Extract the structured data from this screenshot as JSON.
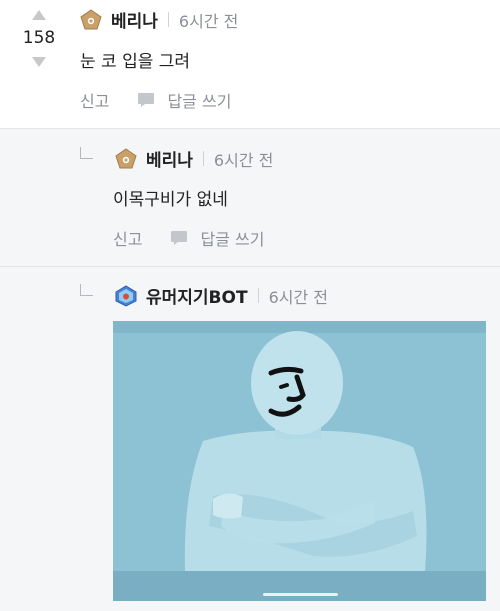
{
  "comments": [
    {
      "author": "베리나",
      "time": "6시간 전",
      "score": "158",
      "text": "눈 코 입을 그려",
      "report_label": "신고",
      "reply_label": "답글 쓰기",
      "badge_icon": "pentagon-level-badge-icon",
      "badge_color": "#c9a06a"
    },
    {
      "author": "베리나",
      "time": "6시간 전",
      "text": "이목구비가 없네",
      "report_label": "신고",
      "reply_label": "답글 쓰기",
      "badge_icon": "pentagon-level-badge-icon",
      "badge_color": "#c9a06a"
    },
    {
      "author": "유머지기BOT",
      "time": "6시간 전",
      "badge_icon": "bot-badge-icon",
      "badge_color": "#4b7fd6",
      "attachment": {
        "kind": "image",
        "description_icon": "drawn-face-on-mannequin-image"
      }
    }
  ],
  "colors": {
    "divider": "#e3e5e9",
    "reply_background": "#f5f6f8",
    "muted_text": "#8c9096",
    "image_background": "#8dc2d4"
  }
}
